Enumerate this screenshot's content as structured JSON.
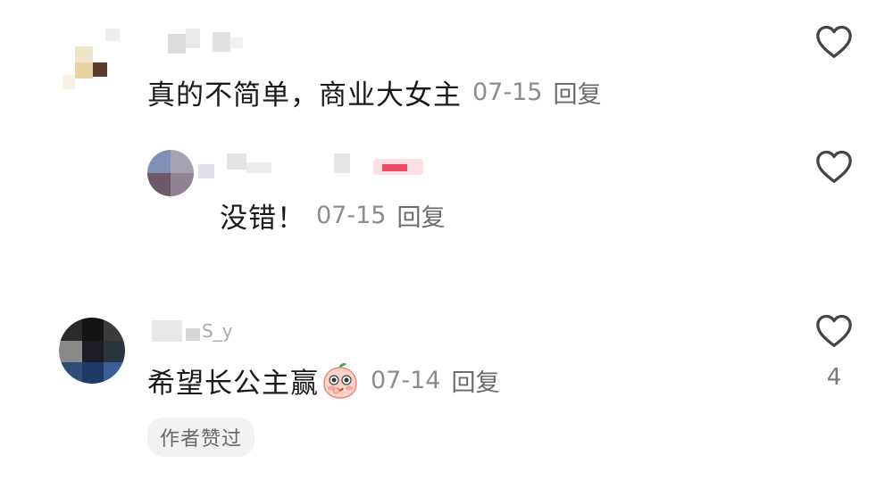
{
  "comments": [
    {
      "text": "真的不简单，商业大女主",
      "date": "07-15",
      "reply_label": "回复",
      "liked": false,
      "like_count": ""
    },
    {
      "text": "没错！",
      "date": "07-15",
      "reply_label": "回复",
      "liked": false,
      "like_count": ""
    },
    {
      "username_visible": "S_y",
      "text": "希望长公主赢",
      "emoji": "peach-face-emoji",
      "date": "07-14",
      "reply_label": "回复",
      "liked": false,
      "like_count": "4",
      "badge": "作者赞过"
    }
  ],
  "colors": {
    "text": "#1a1a1a",
    "meta": "#8c8c8c",
    "icon": "#444444",
    "badge_bg": "#f2f2f2"
  }
}
